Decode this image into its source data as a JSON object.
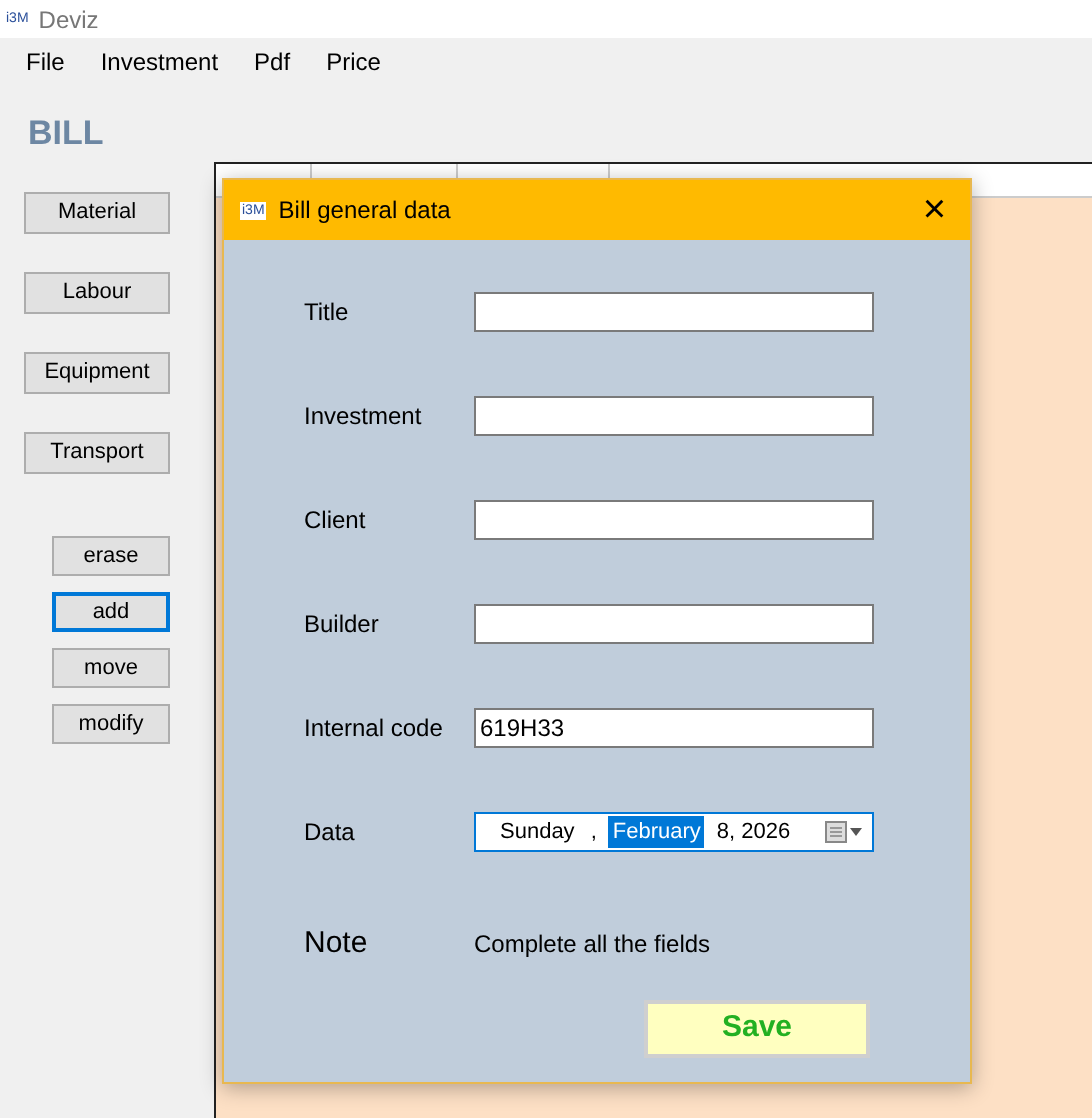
{
  "window": {
    "title": "Deviz",
    "logo": "i3M"
  },
  "menu": [
    "File",
    "Investment",
    "Pdf",
    "Price"
  ],
  "heading": "BILL",
  "category_buttons": [
    {
      "label": "Material"
    },
    {
      "label": "Labour"
    },
    {
      "label": "Equipment"
    },
    {
      "label": "Transport"
    }
  ],
  "action_buttons": [
    {
      "label": "erase",
      "focused": false
    },
    {
      "label": "add",
      "focused": true
    },
    {
      "label": "move",
      "focused": false
    },
    {
      "label": "modify",
      "focused": false
    }
  ],
  "dialog": {
    "logo": "i3M",
    "title": "Bill general data",
    "close": "×",
    "fields": [
      {
        "label": "Title"
      },
      {
        "label": "Investment"
      },
      {
        "label": "Client"
      },
      {
        "label": "Builder"
      },
      {
        "label": "Internal code",
        "value": "619H33"
      }
    ],
    "date": {
      "label": "Data",
      "segments": [
        {
          "text": "Sunday",
          "selected": false
        },
        {
          "text": ",",
          "selected": false
        },
        {
          "text": "February",
          "selected": true
        },
        {
          "text": "8, 2026",
          "selected": false
        }
      ]
    },
    "note": {
      "label": "Note",
      "text": "Complete all the fields"
    },
    "save": "Save"
  }
}
